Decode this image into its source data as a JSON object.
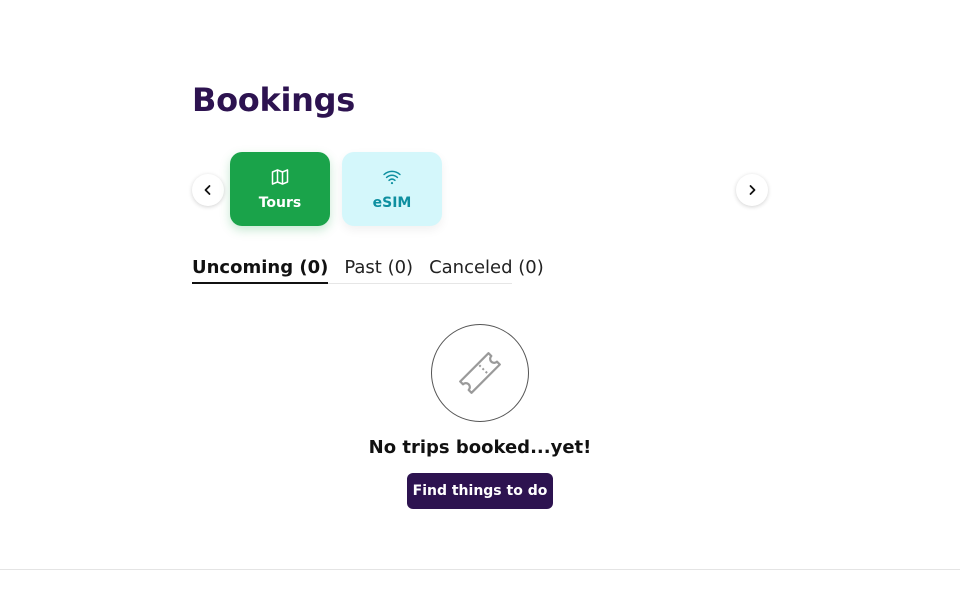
{
  "header": {
    "title": "Bookings"
  },
  "categories": [
    {
      "label": "Tours",
      "icon": "map-icon",
      "selected": true,
      "color": "#1aa34a"
    },
    {
      "label": "eSIM",
      "icon": "wifi-icon",
      "selected": false,
      "color": "#d4f7fb"
    }
  ],
  "carousel": {
    "prev_icon": "chevron-left-icon",
    "next_icon": "chevron-right-icon"
  },
  "tabs": [
    {
      "label": "Uncoming (0)",
      "active": true
    },
    {
      "label": "Past (0)",
      "active": false
    },
    {
      "label": "Canceled (0)",
      "active": false
    }
  ],
  "empty_state": {
    "icon": "ticket-icon",
    "title": "No trips booked...yet!",
    "cta_label": "Find things to do"
  },
  "theme": {
    "brand": "#2d1350",
    "tours_green": "#1aa34a",
    "esim_cyan": "#d4f7fb",
    "esim_text": "#0e8fa0"
  }
}
